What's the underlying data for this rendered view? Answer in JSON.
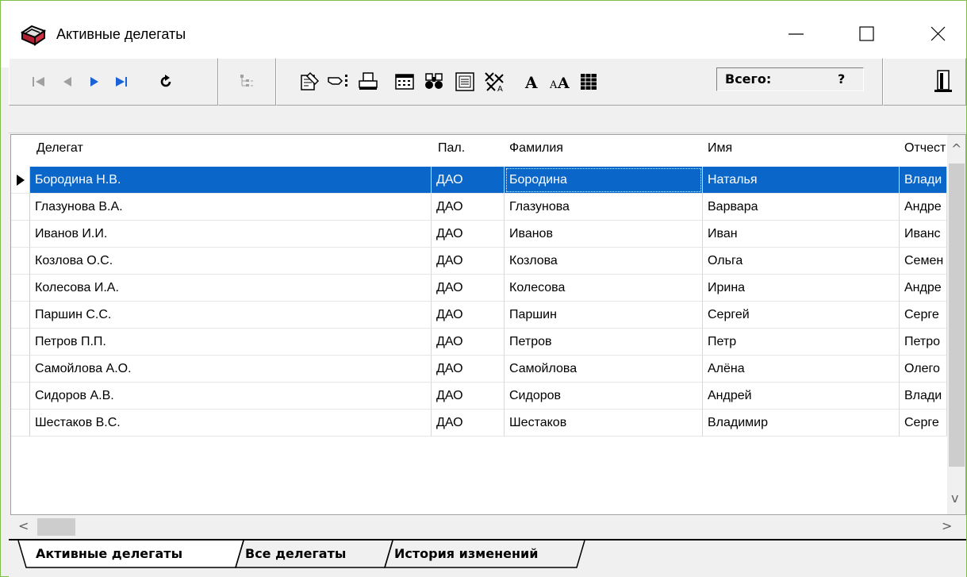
{
  "window": {
    "title": "Активные делегаты"
  },
  "toolbar": {
    "nav_icons": [
      "first-record-icon",
      "prior-record-icon",
      "next-record-icon",
      "last-record-icon",
      "refresh-icon"
    ],
    "tool_icons": [
      "tree-icon",
      "edit-icon",
      "select-icon",
      "print-icon",
      "calculator-icon",
      "binoculars-icon",
      "form-icon",
      "filter-icon",
      "font-bold-icon",
      "font-size-icon",
      "grid-icon",
      "exit-icon"
    ],
    "total_label": "Всего:",
    "total_value": "?"
  },
  "colors": {
    "selection": "#0a66c8",
    "window_border": "#7cbf4a",
    "nav_blue": "#1a62d6"
  },
  "table": {
    "columns": [
      "Делегат",
      "Пал.",
      "Фамилия",
      "Имя",
      "Отчест"
    ],
    "rows": [
      [
        "Бородина Н.В.",
        "ДАО",
        "Бородина",
        "Наталья",
        "Влади"
      ],
      [
        "Глазунова В.А.",
        "ДАО",
        "Глазунова",
        "Варвара",
        "Андре"
      ],
      [
        "Иванов И.И.",
        "ДАО",
        "Иванов",
        "Иван",
        "Иванс"
      ],
      [
        "Козлова О.С.",
        "ДАО",
        "Козлова",
        "Ольга",
        "Семен"
      ],
      [
        "Колесова И.А.",
        "ДАО",
        "Колесова",
        "Ирина",
        "Андре"
      ],
      [
        "Паршин С.С.",
        "ДАО",
        "Паршин",
        "Сергей",
        "Серге"
      ],
      [
        "Петров П.П.",
        "ДАО",
        "Петров",
        "Петр",
        "Петро"
      ],
      [
        "Самойлова А.О.",
        "ДАО",
        "Самойлова",
        "Алёна",
        "Олего"
      ],
      [
        "Сидоров А.В.",
        "ДАО",
        "Сидоров",
        "Андрей",
        "Влади"
      ],
      [
        "Шестаков В.С.",
        "ДАО",
        "Шестаков",
        "Владимир",
        "Серге"
      ]
    ],
    "selected_row": 0
  },
  "tabs": [
    "Активные делегаты",
    "Все делегаты",
    "История изменений"
  ],
  "active_tab": 0
}
